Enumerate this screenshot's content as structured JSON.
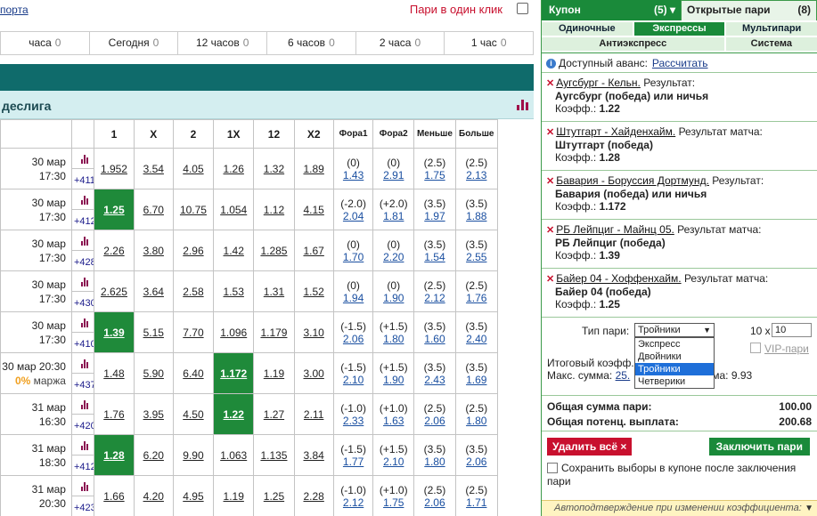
{
  "top": {
    "link": "порта",
    "one_click": "Пари в один клик"
  },
  "timefilters": [
    {
      "label": "часа",
      "count": "0"
    },
    {
      "label": "Сегодня",
      "count": "0"
    },
    {
      "label": "12 часов",
      "count": "0"
    },
    {
      "label": "6 часов",
      "count": "0"
    },
    {
      "label": "2 часа",
      "count": "0"
    },
    {
      "label": "1 час",
      "count": "0"
    }
  ],
  "league": {
    "title": "деслига"
  },
  "columns": [
    "1",
    "X",
    "2",
    "1X",
    "12",
    "X2",
    "Фора1",
    "Фора2",
    "Меньше",
    "Больше"
  ],
  "events": [
    {
      "date": "30 мар",
      "time": "17:30",
      "more": "+411",
      "odds": [
        "1.952",
        "3.54",
        "4.05",
        "1.26",
        "1.32",
        "1.89"
      ],
      "h1v": "(0)",
      "h1": "1.43",
      "h2v": "(0)",
      "h2": "2.91",
      "uv": "(2.5)",
      "u": "1.75",
      "ov": "(2.5)",
      "o": "2.13"
    },
    {
      "date": "30 мар",
      "time": "17:30",
      "more": "+412",
      "odds": [
        "1.25",
        "6.70",
        "10.75",
        "1.054",
        "1.12",
        "4.15"
      ],
      "h1v": "(-2.0)",
      "h1": "2.04",
      "h2v": "(+2.0)",
      "h2": "1.81",
      "uv": "(3.5)",
      "u": "1.97",
      "ov": "(3.5)",
      "o": "1.88"
    },
    {
      "date": "30 мар",
      "time": "17:30",
      "more": "+428",
      "odds": [
        "2.26",
        "3.80",
        "2.96",
        "1.42",
        "1.285",
        "1.67"
      ],
      "h1v": "(0)",
      "h1": "1.70",
      "h2v": "(0)",
      "h2": "2.20",
      "uv": "(3.5)",
      "u": "1.54",
      "ov": "(3.5)",
      "o": "2.55"
    },
    {
      "date": "30 мар",
      "time": "17:30",
      "more": "+430",
      "odds": [
        "2.625",
        "3.64",
        "2.58",
        "1.53",
        "1.31",
        "1.52"
      ],
      "h1v": "(0)",
      "h1": "1.94",
      "h2v": "(0)",
      "h2": "1.90",
      "uv": "(2.5)",
      "u": "2.12",
      "ov": "(2.5)",
      "o": "1.76"
    },
    {
      "date": "30 мар",
      "time": "17:30",
      "more": "+410",
      "odds": [
        "1.39",
        "5.15",
        "7.70",
        "1.096",
        "1.179",
        "3.10"
      ],
      "h1v": "(-1.5)",
      "h1": "2.06",
      "h2v": "(+1.5)",
      "h2": "1.80",
      "uv": "(3.5)",
      "u": "1.60",
      "ov": "(3.5)",
      "o": "2.40"
    },
    {
      "date": "30 мар 20:30",
      "time": "",
      "margin_pct": "0%",
      "margin_label": "маржа",
      "more": "+437",
      "odds": [
        "1.48",
        "5.90",
        "6.40",
        "1.172",
        "1.19",
        "3.00"
      ],
      "h1v": "(-1.5)",
      "h1": "2.10",
      "h2v": "(+1.5)",
      "h2": "1.90",
      "uv": "(3.5)",
      "u": "2.43",
      "ov": "(3.5)",
      "o": "1.69"
    },
    {
      "date": "31 мар",
      "time": "16:30",
      "more": "+420",
      "odds": [
        "1.76",
        "3.95",
        "4.50",
        "1.22",
        "1.27",
        "2.11"
      ],
      "h1v": "(-1.0)",
      "h1": "2.33",
      "h2v": "(+1.0)",
      "h2": "1.63",
      "uv": "(2.5)",
      "u": "2.06",
      "ov": "(2.5)",
      "o": "1.80"
    },
    {
      "date": "31 мар",
      "time": "18:30",
      "more": "+412",
      "odds": [
        "1.28",
        "6.20",
        "9.90",
        "1.063",
        "1.135",
        "3.84"
      ],
      "h1v": "(-1.5)",
      "h1": "1.77",
      "h2v": "(+1.5)",
      "h2": "2.10",
      "uv": "(3.5)",
      "u": "1.80",
      "ov": "(3.5)",
      "o": "2.06"
    },
    {
      "date": "31 мар",
      "time": "20:30",
      "more": "+423",
      "odds": [
        "1.66",
        "4.20",
        "4.95",
        "1.19",
        "1.25",
        "2.28"
      ],
      "h1v": "(-1.0)",
      "h1": "2.12",
      "h2v": "(+1.0)",
      "h2": "1.75",
      "uv": "(2.5)",
      "u": "2.06",
      "ov": "(2.5)",
      "o": "1.71"
    }
  ],
  "highlighted": [
    [
      1,
      0
    ],
    [
      4,
      0
    ],
    [
      5,
      3
    ],
    [
      6,
      3
    ],
    [
      7,
      0
    ]
  ],
  "coupon": {
    "tab_label": "Купон",
    "tab_count": "(5)",
    "open_label": "Открытые пари",
    "open_count": "(8)",
    "types": [
      "Одиночные",
      "Экспрессы",
      "Мультипари"
    ],
    "types2": [
      "Антиэкспресс",
      "Система"
    ],
    "advance_label": "Доступный аванс:",
    "advance_link": "Рассчитать",
    "bets": [
      {
        "event": "Аугсбург - Кельн.",
        "rtype": "Результат:",
        "result": "Аугсбург (победа) или ничья",
        "coef_label": "Коэфф.:",
        "coef": "1.22"
      },
      {
        "event": "Штутгарт - Хайденхайм.",
        "rtype": "Результат матча:",
        "result": "Штутгарт (победа)",
        "coef_label": "Коэфф.:",
        "coef": "1.28"
      },
      {
        "event": "Бавария - Боруссия Дортмунд.",
        "rtype": "Результат:",
        "result": "Бавария (победа) или ничья",
        "coef_label": "Коэфф.:",
        "coef": "1.172"
      },
      {
        "event": "РБ Лейпциг - Майнц 05.",
        "rtype": "Результат матча:",
        "result": "РБ Лейпциг (победа)",
        "coef_label": "Коэфф.:",
        "coef": "1.39"
      },
      {
        "event": "Байер 04 - Хоффенхайм.",
        "rtype": "Результат матча:",
        "result": "Байер 04 (победа)",
        "coef_label": "Коэфф.:",
        "coef": "1.25"
      }
    ],
    "bet_type_label": "Тип пари:",
    "bet_type_value": "Тройники",
    "bet_type_options": [
      "Экспресс",
      "Двойники",
      "Тройники",
      "Четверики"
    ],
    "mult_label": "10 x",
    "mult_value": "10",
    "vip_label": "VIP-пари",
    "total_coef_label": "Итоговый коэфф.",
    "max_sum_label": "Макс. сумма:",
    "max_sum_link": "25.",
    "hint_label": "мма:",
    "hint_value": "9.93",
    "total_sum_label": "Общая сумма пари:",
    "total_sum": "100.00",
    "payout_label": "Общая потенц. выплата:",
    "payout": "200.68",
    "delete_label": "Удалить всё",
    "place_label": "Заключить пари",
    "save_label": "Сохранить выборы в купоне после заключения пари",
    "auto_label": "Автоподтверждение при изменении коэффициента:"
  }
}
